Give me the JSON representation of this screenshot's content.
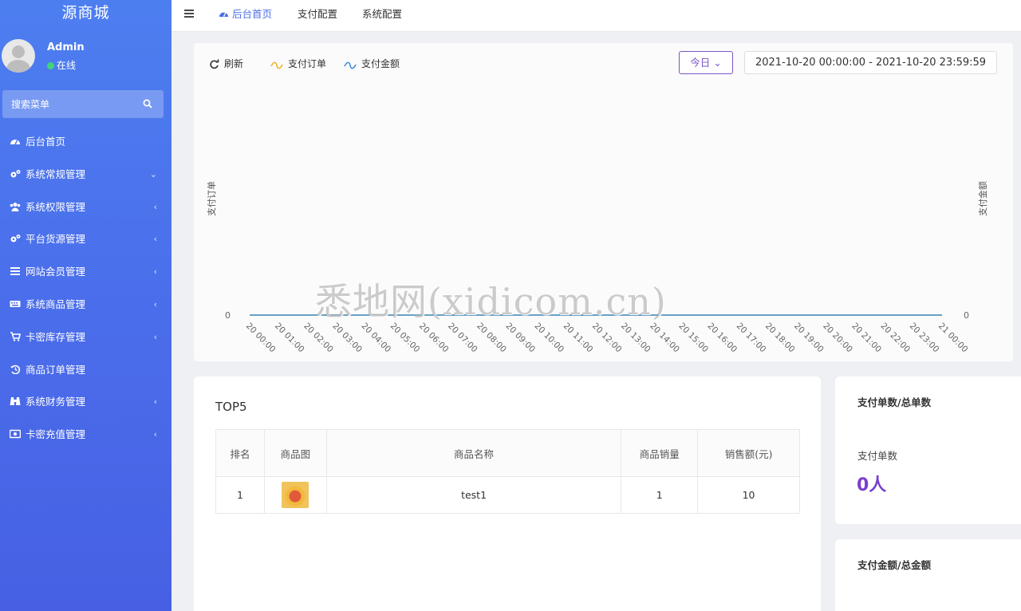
{
  "app": {
    "brand": "源商城"
  },
  "user": {
    "name": "Admin",
    "status": "在线"
  },
  "search": {
    "placeholder": "搜索菜单"
  },
  "sidebar": {
    "items": [
      {
        "label": "后台首页",
        "icon": "dashboard-icon",
        "chevron": ""
      },
      {
        "label": "系统常规管理",
        "icon": "cogs-icon",
        "chevron": "⌄"
      },
      {
        "label": "系统权限管理",
        "icon": "users-icon",
        "chevron": "‹"
      },
      {
        "label": "平台货源管理",
        "icon": "cogs-icon",
        "chevron": "‹"
      },
      {
        "label": "网站会员管理",
        "icon": "list-icon",
        "chevron": "‹"
      },
      {
        "label": "系统商品管理",
        "icon": "keyboard-icon",
        "chevron": "‹"
      },
      {
        "label": "卡密库存管理",
        "icon": "cart-icon",
        "chevron": "‹"
      },
      {
        "label": "商品订单管理",
        "icon": "history-icon",
        "chevron": ""
      },
      {
        "label": "系统财务管理",
        "icon": "binoculars-icon",
        "chevron": "‹"
      },
      {
        "label": "卡密充值管理",
        "icon": "card-icon",
        "chevron": "‹"
      }
    ]
  },
  "topbar": {
    "tabs": [
      {
        "label": "后台首页",
        "active": true
      },
      {
        "label": "支付配置",
        "active": false
      },
      {
        "label": "系统配置",
        "active": false
      }
    ]
  },
  "chart_toolbar": {
    "refresh_label": "刷新",
    "date_button": "今日 ⌄",
    "date_range": "2021-10-20 00:00:00  -  2021-10-20 23:59:59"
  },
  "chart_data": {
    "type": "line",
    "legend": [
      "支付订单",
      "支付金额"
    ],
    "y_left_label": "支付订单",
    "y_right_label": "支付金额",
    "y_left_ticks": [
      "0"
    ],
    "y_right_ticks": [
      "0"
    ],
    "categories": [
      "20 00:00",
      "20 01:00",
      "20 02:00",
      "20 03:00",
      "20 04:00",
      "20 05:00",
      "20 06:00",
      "20 07:00",
      "20 08:00",
      "20 09:00",
      "20 10:00",
      "20 11:00",
      "20 12:00",
      "20 13:00",
      "20 14:00",
      "20 15:00",
      "20 16:00",
      "20 17:00",
      "20 18:00",
      "20 19:00",
      "20 20:00",
      "20 21:00",
      "20 22:00",
      "20 23:00",
      "21 00:00"
    ],
    "series": [
      {
        "name": "支付订单",
        "color": "#f0b323",
        "values": [
          0,
          0,
          0,
          0,
          0,
          0,
          0,
          0,
          0,
          0,
          0,
          0,
          0,
          0,
          0,
          0,
          0,
          0,
          0,
          0,
          0,
          0,
          0,
          0,
          0
        ]
      },
      {
        "name": "支付金额",
        "color": "#3b8fd6",
        "values": [
          0,
          0,
          0,
          0,
          0,
          0,
          0,
          0,
          0,
          0,
          0,
          0,
          0,
          0,
          0,
          0,
          0,
          0,
          0,
          0,
          0,
          0,
          0,
          0,
          0
        ]
      }
    ]
  },
  "top5": {
    "title": "TOP5",
    "columns": [
      "排名",
      "商品图",
      "商品名称",
      "商品销量",
      "销售额(元)"
    ],
    "rows": [
      {
        "rank": "1",
        "name": "test1",
        "sales": "1",
        "amount": "10"
      }
    ]
  },
  "stats": {
    "orders_card_title": "支付单数/总单数",
    "orders_label": "支付单数",
    "orders_value": "0人",
    "amount_card_title": "支付金额/总金额"
  },
  "watermark": "悉地网(xidicom.cn)",
  "colors": {
    "sidebar": "#4a6bea",
    "accent": "#7a3fd0",
    "tab_active": "#4d6fe6"
  }
}
